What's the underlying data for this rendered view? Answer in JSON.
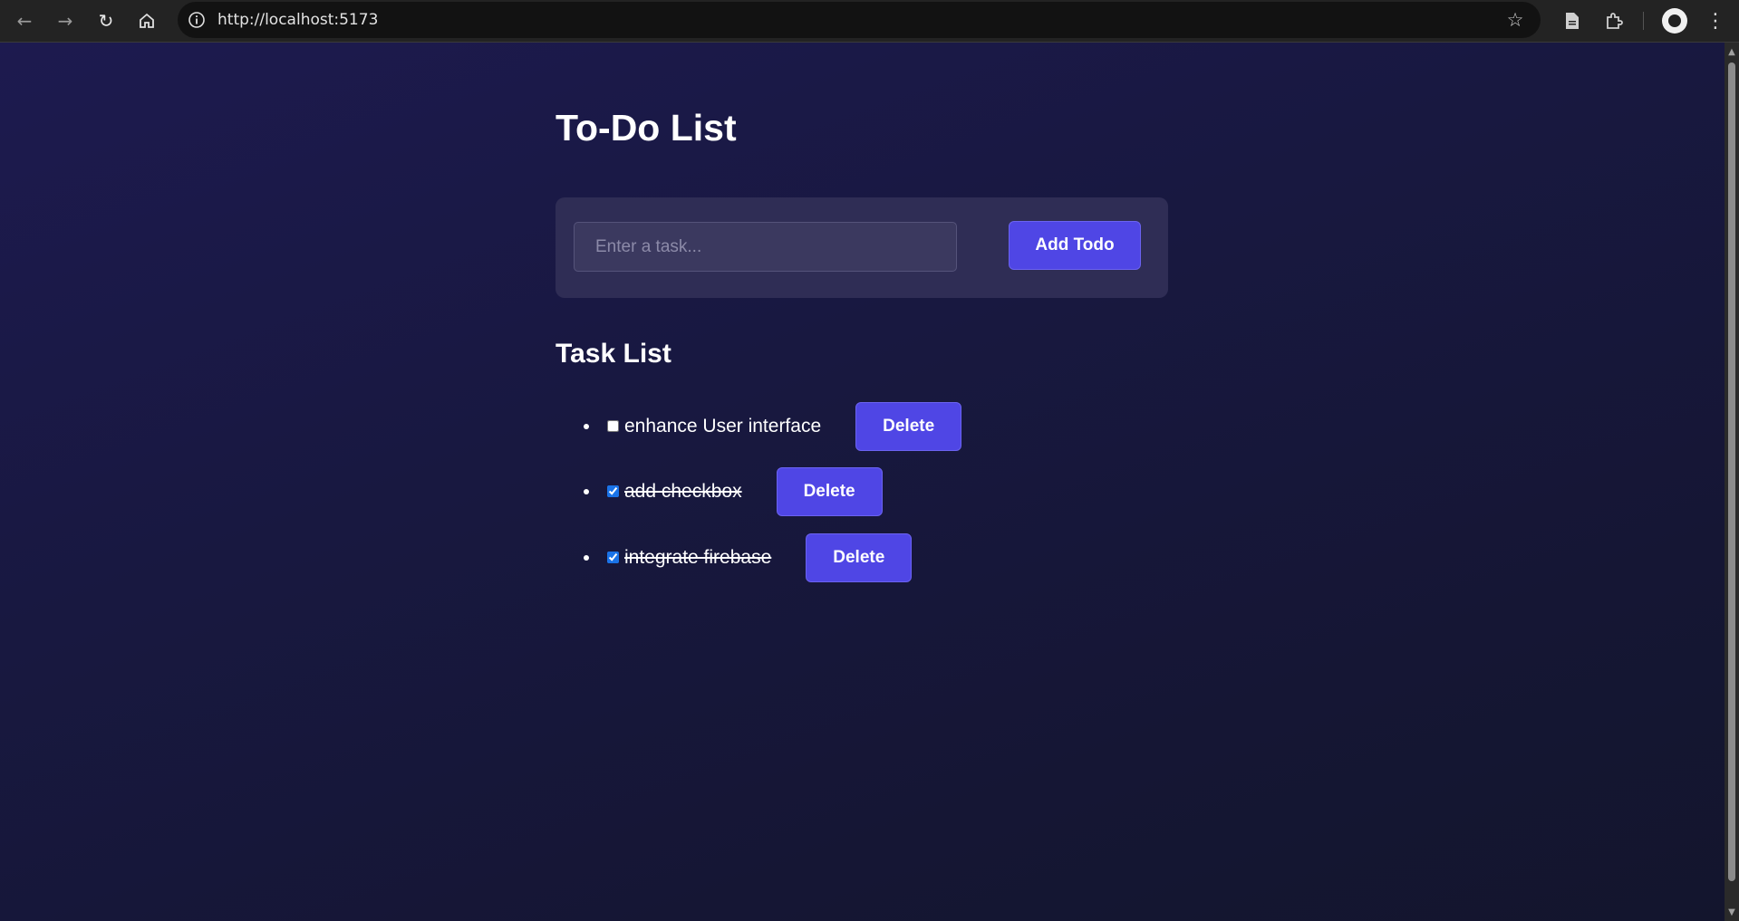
{
  "browser": {
    "url": "http://localhost:5173"
  },
  "app": {
    "title": "To-Do List",
    "input_placeholder": "Enter a task...",
    "add_button_label": "Add Todo",
    "list_title": "Task List",
    "tasks": [
      {
        "text": "enhance User interface",
        "completed": false,
        "delete_label": "Delete"
      },
      {
        "text": "add checkbox",
        "completed": true,
        "delete_label": "Delete"
      },
      {
        "text": "integrate firebase",
        "completed": true,
        "delete_label": "Delete"
      }
    ]
  },
  "colors": {
    "accent": "#4f46e5",
    "background": "#171838",
    "card": "#2f2d55"
  }
}
